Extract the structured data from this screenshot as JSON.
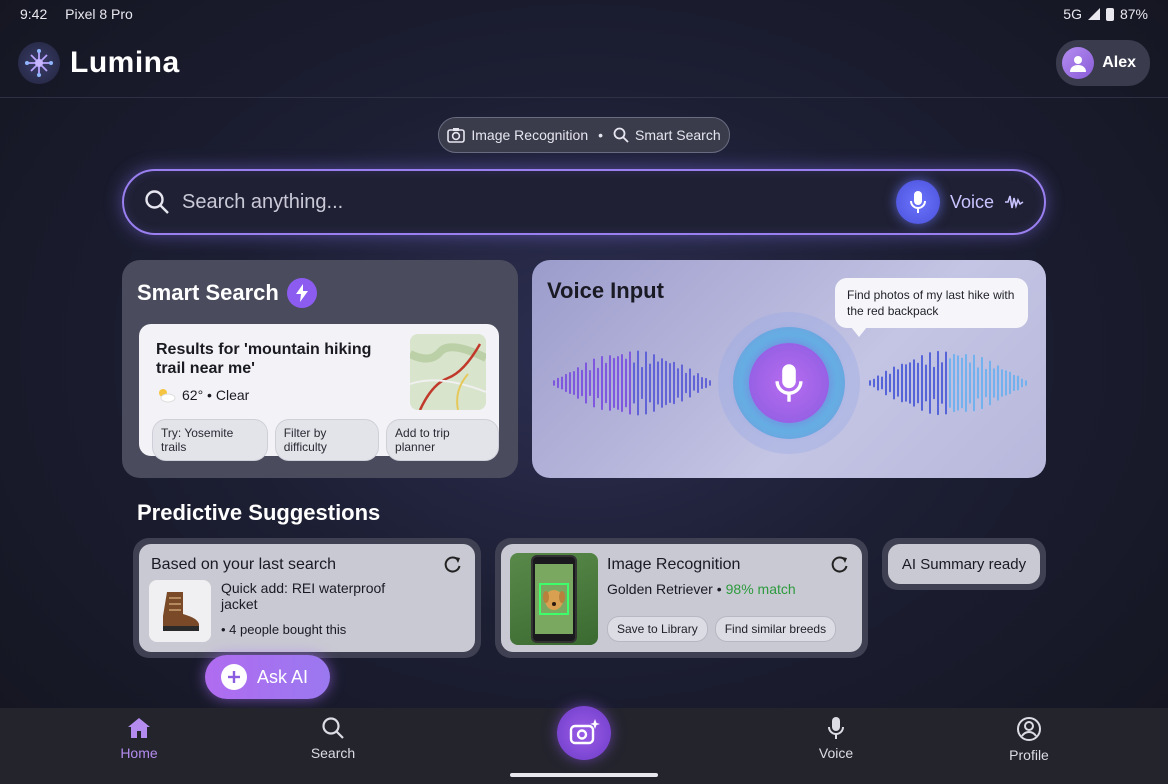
{
  "status": {
    "time": "9:42",
    "device": "Pixel 8 Pro",
    "network": "5G",
    "battery": "87%"
  },
  "header": {
    "brand": "Lumina",
    "user": "Alex"
  },
  "feature_chip": {
    "left": "Image Recognition",
    "separator": "•",
    "right": "Smart Search"
  },
  "search": {
    "placeholder": "Search anything...",
    "voice_label": "Voice"
  },
  "smart_search": {
    "title": "Smart Search",
    "result_title": "Results for 'mountain hiking trail near me'",
    "weather": "62° • Clear",
    "chips": [
      "Try: Yosemite trails",
      "Filter by difficulty",
      "Add to trip planner"
    ]
  },
  "voice_input": {
    "title": "Voice Input",
    "bubble": "Find photos of my last hike with the red backpack"
  },
  "predictive": {
    "title": "Predictive Suggestions",
    "card1": {
      "title": "Based on your last search",
      "desc": "Quick add: REI waterproof jacket",
      "meta": "• 4 people bought this"
    },
    "card2": {
      "title": "Image Recognition",
      "breed": "Golden Retriever •",
      "match": "98% match",
      "chips": [
        "Save to Library",
        "Find similar breeds"
      ]
    },
    "card3": {
      "title": "AI Summary ready"
    }
  },
  "ask_ai": {
    "label": "Ask AI"
  },
  "nav": {
    "home": "Home",
    "search": "Search",
    "voice": "Voice",
    "profile": "Profile"
  },
  "colors": {
    "accent": "#9a7ff0",
    "active_nav": "#b48cf0",
    "match_green": "#2e9a3e"
  }
}
